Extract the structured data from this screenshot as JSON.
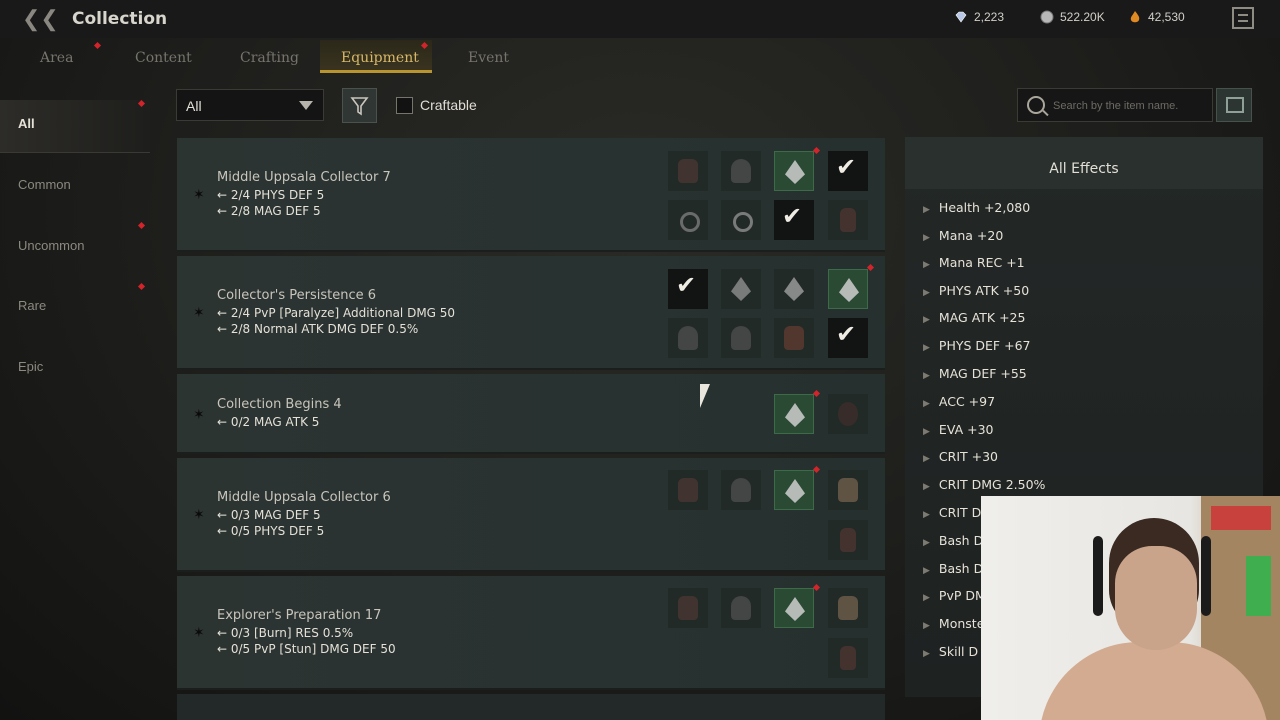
{
  "header": {
    "title": "Collection",
    "currencies": [
      {
        "icon": "diamond-icon",
        "value": "2,223"
      },
      {
        "icon": "silver-coin-icon",
        "value": "522.20K"
      },
      {
        "icon": "flame-gem-icon",
        "value": "42,530"
      }
    ]
  },
  "tabs": [
    {
      "label": "Area",
      "alert": true
    },
    {
      "label": "Content",
      "alert": false
    },
    {
      "label": "Crafting",
      "alert": false
    },
    {
      "label": "Equipment",
      "alert": true,
      "active": true
    },
    {
      "label": "Event",
      "alert": false
    }
  ],
  "sidebar": {
    "items": [
      {
        "label": "All",
        "active": true,
        "alert": true
      },
      {
        "label": "Common",
        "alert": false
      },
      {
        "label": "Uncommon",
        "alert": true
      },
      {
        "label": "Rare",
        "alert": true
      },
      {
        "label": "Epic",
        "alert": false
      }
    ]
  },
  "filters": {
    "dropdown_value": "All",
    "craftable_label": "Craftable",
    "craftable_checked": false,
    "search_placeholder": "Search by the item name."
  },
  "collections": [
    {
      "name": "Middle Uppsala Collector 7",
      "effects": [
        "2/4 PHYS DEF 5",
        "2/8 MAG DEF 5"
      ]
    },
    {
      "name": "Collector's Persistence 6",
      "effects": [
        "2/4 PvP [Paralyze] Additional DMG 50",
        "2/8 Normal ATK DMG DEF 0.5%"
      ]
    },
    {
      "name": "Collection Begins 4",
      "effects": [
        "0/2 MAG ATK 5"
      ]
    },
    {
      "name": "Middle Uppsala Collector 6",
      "effects": [
        "0/3 MAG DEF 5",
        "0/5 PHYS DEF 5"
      ]
    },
    {
      "name": "Explorer's Preparation 17",
      "effects": [
        "0/3 [Burn] RES 0.5%",
        "0/5 PvP [Stun] DMG DEF 50"
      ]
    }
  ],
  "all_effects": {
    "title": "All Effects",
    "items": [
      "Health +2,080",
      "Mana +20",
      "Mana REC +1",
      "PHYS ATK +50",
      "MAG ATK +25",
      "PHYS DEF +67",
      "MAG DEF +55",
      "ACC +97",
      "EVA +30",
      "CRIT +30",
      "CRIT DMG 2.50%",
      "CRIT D",
      "Bash D",
      "Bash D",
      "PvP DM",
      "Monste",
      "Skill D"
    ]
  },
  "colors": {
    "accent_gold": "#d8b868",
    "alert_red": "#d2242a",
    "owned_slot_green": "#2b4a34"
  }
}
